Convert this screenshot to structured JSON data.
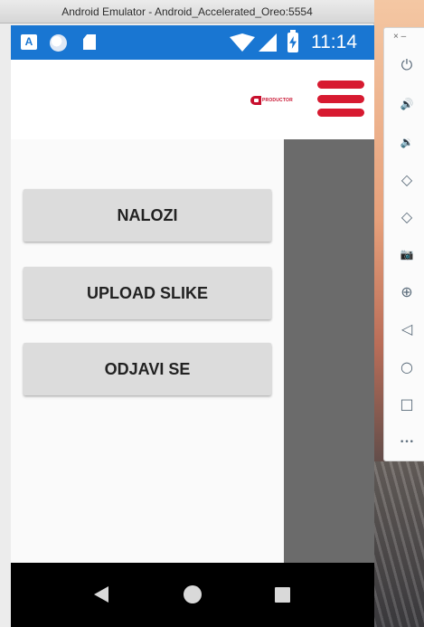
{
  "window": {
    "title": "Android Emulator - Android_Accelerated_Oreo:5554"
  },
  "statusbar": {
    "time": "11:14",
    "icons": [
      "android-a-icon",
      "circle-icon",
      "sd-card-icon",
      "wifi-icon",
      "signal-icon",
      "battery-charging-icon"
    ]
  },
  "appbar": {
    "logo_text": "PRODUCTOR",
    "menu_icon": "hamburger-menu-icon"
  },
  "drawer": {
    "items": [
      {
        "label": "NALOZI"
      },
      {
        "label": "UPLOAD SLIKE"
      },
      {
        "label": "ODJAVI SE"
      }
    ]
  },
  "navbar": {
    "icons": [
      "back-icon",
      "home-icon",
      "recents-icon"
    ]
  },
  "emulator_toolbar": {
    "window_controls": "×  –",
    "items": [
      {
        "name": "power-icon",
        "glyph": "⏻"
      },
      {
        "name": "volume-up-icon",
        "glyph": "🔊"
      },
      {
        "name": "volume-down-icon",
        "glyph": "🔉"
      },
      {
        "name": "rotate-left-icon",
        "glyph": "◇"
      },
      {
        "name": "rotate-right-icon",
        "glyph": "◇"
      },
      {
        "name": "camera-icon",
        "glyph": "📷"
      },
      {
        "name": "zoom-icon",
        "glyph": "⊕"
      },
      {
        "name": "back-icon",
        "glyph": "◁"
      },
      {
        "name": "home-icon",
        "glyph": "○"
      },
      {
        "name": "overview-icon",
        "glyph": "□"
      },
      {
        "name": "more-icon",
        "glyph": "•••"
      }
    ]
  },
  "colors": {
    "statusbar": "#1976d2",
    "accent": "#d71a30",
    "button": "#dcdcdc",
    "scrim": "#6b6b6b"
  }
}
